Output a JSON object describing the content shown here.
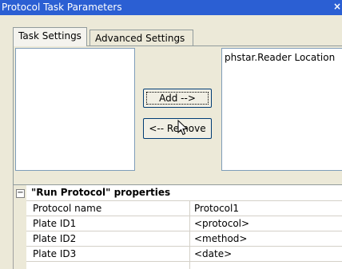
{
  "window": {
    "title": "Protocol Task Parameters",
    "close_glyph": "×"
  },
  "tabs": [
    {
      "label": "Task Settings",
      "active": true
    },
    {
      "label": "Advanced Settings",
      "active": false
    }
  ],
  "left_list": {
    "items": []
  },
  "right_list": {
    "items": [
      "phstar.Reader Location"
    ]
  },
  "buttons": {
    "add": "Add -->",
    "remove": "<-- Remove"
  },
  "properties": {
    "expander_glyph": "−",
    "heading": "\"Run Protocol\" properties",
    "rows": [
      {
        "name": "Protocol name",
        "value": "Protocol1"
      },
      {
        "name": "Plate ID1",
        "value": "<protocol>"
      },
      {
        "name": "Plate ID2",
        "value": "<method>"
      },
      {
        "name": "Plate ID3",
        "value": "<date>"
      },
      {
        "name": "",
        "value": ""
      }
    ]
  },
  "colors": {
    "titlebar": "#2b5fd3",
    "panel": "#ece9d8",
    "button_border": "#003c74"
  },
  "icons": {
    "cursor": "arrow-pointer-icon"
  }
}
